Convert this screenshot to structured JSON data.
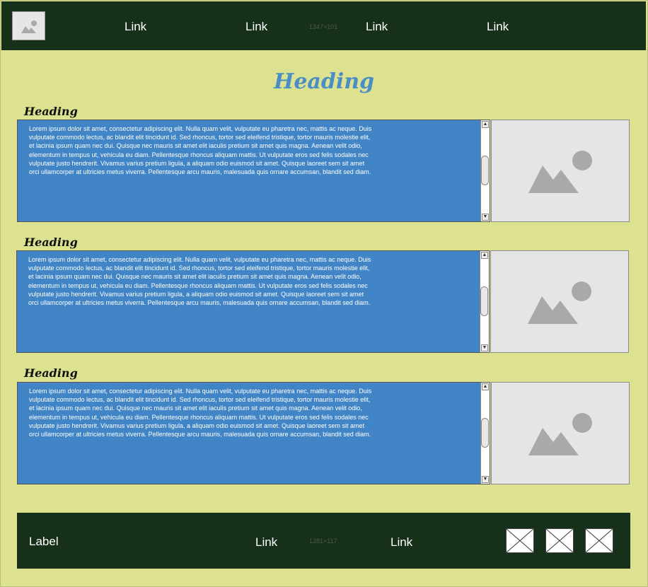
{
  "nav": {
    "links": [
      "Link",
      "Link",
      "Link",
      "Link"
    ],
    "size_note": "1347×101",
    "logo_icon": "image-placeholder-icon"
  },
  "main": {
    "title": "Heading",
    "sections": [
      {
        "heading": "Heading",
        "text": "Lorem ipsum dolor sit amet, consectetur adipiscing elit. Nulla quam velit, vulputate eu pharetra nec, mattis ac neque. Duis vulputate commodo lectus, ac blandit elit tincidunt id. Sed rhoncus, tortor sed eleifend tristique, tortor mauris molestie elit, et lacinia ipsum quam nec dui. Quisque nec mauris sit amet elit iaculis pretium sit amet quis magna. Aenean velit odio, elementum in tempus ut, vehicula eu diam. Pellentesque rhoncus aliquam mattis. Ut vulputate eros sed felis sodales nec vulputate justo hendrerit. Vivamus varius pretium ligula, a aliquam odio euismod sit amet. Quisque laoreet sem sit amet orci ullamcorper at ultricies metus viverra. Pellentesque arcu mauris, malesuada quis ornare accumsan, blandit sed diam.",
        "image_icon": "image-placeholder-icon"
      },
      {
        "heading": "Heading",
        "text": "Lorem ipsum dolor sit amet, consectetur adipiscing elit. Nulla quam velit, vulputate eu pharetra nec, mattis ac neque. Duis vulputate commodo lectus, ac blandit elit tincidunt id. Sed rhoncus, tortor sed eleifend tristique, tortor mauris molestie elit, et lacinia ipsum quam nec dui. Quisque nec mauris sit amet elit iaculis pretium sit amet quis magna. Aenean velit odio, elementum in tempus ut, vehicula eu diam. Pellentesque rhoncus aliquam mattis. Ut vulputate eros sed felis sodales nec vulputate justo hendrerit. Vivamus varius pretium ligula, a aliquam odio euismod sit amet. Quisque laoreet sem sit amet orci ullamcorper at ultricies metus viverra. Pellentesque arcu mauris, malesuada quis ornare accumsan, blandit sed diam.",
        "image_icon": "image-placeholder-icon"
      },
      {
        "heading": "Heading",
        "text": "Lorem ipsum dolor sit amet, consectetur adipiscing elit. Nulla quam velit, vulputate eu pharetra nec, mattis ac neque. Duis vulputate commodo lectus, ac blandit elit tincidunt id. Sed rhoncus, tortor sed eleifend tristique, tortor mauris molestie elit, et lacinia ipsum quam nec dui. Quisque nec mauris sit amet elit iaculis pretium sit amet quis magna. Aenean velit odio, elementum in tempus ut, vehicula eu diam. Pellentesque rhoncus aliquam mattis. Ut vulputate eros sed felis sodales nec vulputate justo hendrerit. Vivamus varius pretium ligula, a aliquam odio euismod sit amet. Quisque laoreet sem sit amet orci ullamcorper at ultricies metus viverra. Pellentesque arcu mauris, malesuada quis ornare accumsan, blandit sed diam.",
        "image_icon": "image-placeholder-icon"
      }
    ]
  },
  "footer": {
    "label": "Label",
    "links": [
      "Link",
      "Link"
    ],
    "size_note": "1281×117",
    "icons": [
      "broken-image-icon",
      "broken-image-icon",
      "broken-image-icon"
    ]
  },
  "colors": {
    "background": "#dde290",
    "nav_bg": "#17301a",
    "accent_blue": "#4185c6",
    "heading_blue": "#4a8ec5",
    "placeholder_gray": "#e5e5e5"
  }
}
